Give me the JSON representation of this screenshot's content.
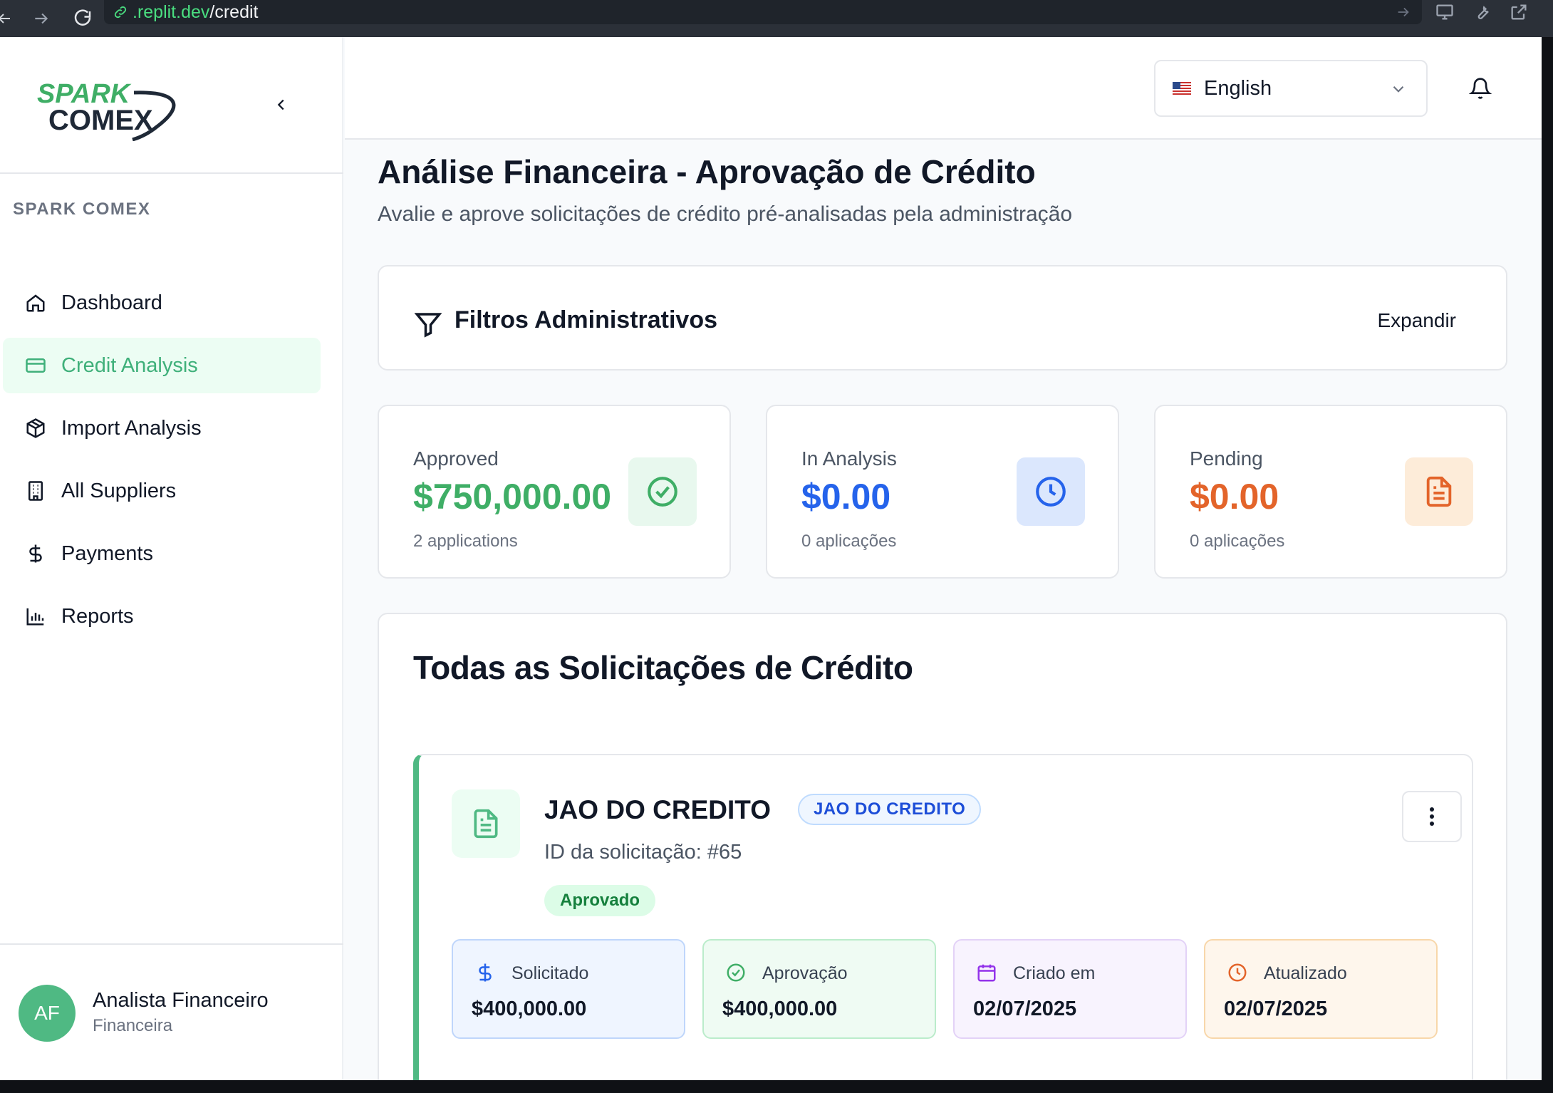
{
  "browser": {
    "url_host": ".replit.dev",
    "url_path": "/credit"
  },
  "sidebar": {
    "brand_top": "SPARK",
    "brand_bottom": "COMEX",
    "section_label": "SPARK COMEX",
    "items": [
      {
        "label": "Dashboard",
        "icon": "home-icon",
        "active": false
      },
      {
        "label": "Credit Analysis",
        "icon": "credit-card-icon",
        "active": true
      },
      {
        "label": "Import Analysis",
        "icon": "package-icon",
        "active": false
      },
      {
        "label": "All Suppliers",
        "icon": "building-icon",
        "active": false
      },
      {
        "label": "Payments",
        "icon": "dollar-icon",
        "active": false
      },
      {
        "label": "Reports",
        "icon": "bar-chart-icon",
        "active": false
      }
    ],
    "user": {
      "initials": "AF",
      "name": "Analista Financeiro",
      "role": "Financeira"
    }
  },
  "header": {
    "language": "English"
  },
  "page": {
    "title": "Análise Financeira - Aprovação de Crédito",
    "subtitle": "Avalie e aprove solicitações de crédito pré-analisadas pela administração"
  },
  "filters": {
    "title": "Filtros Administrativos",
    "expand_label": "Expandir"
  },
  "stats": [
    {
      "label": "Approved",
      "value": "$750,000.00",
      "sub": "2 applications",
      "color": "#3fae66",
      "icon": "check-circle-icon"
    },
    {
      "label": "In Analysis",
      "value": "$0.00",
      "sub": "0 aplicações",
      "color": "#2563eb",
      "icon": "clock-icon"
    },
    {
      "label": "Pending",
      "value": "$0.00",
      "sub": "0 aplicações",
      "color": "#e3642a",
      "icon": "document-icon"
    }
  ],
  "requests": {
    "title": "Todas as Solicitações de Crédito",
    "items": [
      {
        "company": "JAO DO CREDITO",
        "tag": "JAO DO CREDITO",
        "id_text": "ID da solicitação: #65",
        "status": "Aprovado",
        "details": [
          {
            "label": "Solicitado",
            "value": "$400,000.00",
            "icon": "dollar-icon"
          },
          {
            "label": "Aprovação",
            "value": "$400,000.00",
            "icon": "check-circle-icon"
          },
          {
            "label": "Criado em",
            "value": "02/07/2025",
            "icon": "calendar-icon"
          },
          {
            "label": "Atualizado",
            "value": "02/07/2025",
            "icon": "clock-icon"
          }
        ]
      }
    ]
  },
  "colors": {
    "brand_green": "#4fb983",
    "active_nav_bg": "#ecfdf3",
    "approved": "#3fae66",
    "in_analysis": "#2563eb",
    "pending": "#e3642a"
  }
}
